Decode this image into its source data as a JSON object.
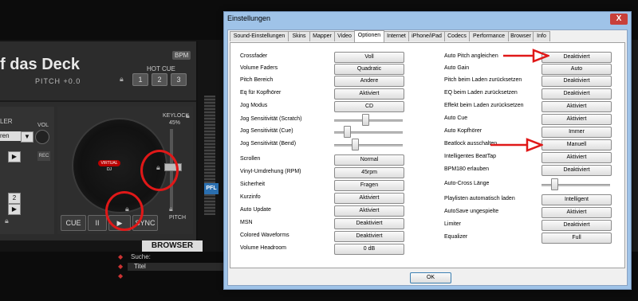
{
  "background_app": {
    "deck_title": "f das Deck",
    "bpm_badge": "BPM",
    "pitch_readout": "PITCH +0.0",
    "hot_cue_label": "HOT CUE",
    "hot_cue_buttons": [
      "1",
      "2",
      "3"
    ],
    "ler_label": "LER",
    "vol_label": "VOL",
    "select_value": "ren",
    "rec_label": "REC",
    "keylock_label": "KEYLOCK",
    "keylock_value": "45%",
    "pitch_label": "PITCH",
    "pfl_label": "PFL",
    "transport": {
      "cue": "CUE",
      "pause": "II",
      "play": "▶",
      "sync": "SYNC"
    },
    "platter_logo": "VIRTUAL DJ",
    "browser_tab": "BROWSER",
    "search_label": "Suche:",
    "list_header": "Titel",
    "side_numbers": [
      "2",
      "2"
    ]
  },
  "dialog": {
    "title": "Einstellungen",
    "close_label": "X",
    "tabs": [
      "Sound-Einstellungen",
      "Skins",
      "Mapper",
      "Video",
      "Optionen",
      "Internet",
      "iPhone/iPad",
      "Codecs",
      "Performance",
      "Browser",
      "Info"
    ],
    "active_tab": "Optionen",
    "left_options": [
      {
        "label": "Crossfader",
        "value": "Voll"
      },
      {
        "label": "Volume Faders",
        "value": "Quadratic"
      },
      {
        "label": "Pitch Bereich",
        "value": "Andere"
      },
      {
        "label": "Eq für Kopfhörer",
        "value": "Aktiviert"
      },
      {
        "label": "Jog Modus",
        "value": "CD"
      },
      {
        "label": "Jog Sensitivität (Scratch)",
        "slider": 0.45
      },
      {
        "label": "Jog Sensitivität (Cue)",
        "slider": 0.15
      },
      {
        "label": "Jog Sensitivität (Bend)",
        "slider": 0.28
      },
      {
        "label": "Scrollen",
        "value": "Normal"
      },
      {
        "label": "VinyI-Umdrehung (RPM)",
        "value": "45rpm"
      },
      {
        "label": "Sicherheit",
        "value": "Fragen"
      },
      {
        "label": "Kurzinfo",
        "value": "Aktiviert"
      },
      {
        "label": "Auto Update",
        "value": "Aktiviert"
      },
      {
        "label": "MSN",
        "value": "Deaktiviert"
      },
      {
        "label": "Colored Waveforms",
        "value": "Deaktiviert"
      },
      {
        "label": "Volume Headroom",
        "value": "0 dB"
      }
    ],
    "right_options": [
      {
        "label": "Auto Pitch angleichen",
        "value": "Deaktiviert"
      },
      {
        "label": "Auto Gain",
        "value": "Auto"
      },
      {
        "label": "Pitch beim Laden zurücksetzen",
        "value": "Deaktiviert"
      },
      {
        "label": "EQ beim Laden zurücksetzen",
        "value": "Deaktiviert"
      },
      {
        "label": "Effekt beim Laden zurücksetzen",
        "value": "Aktiviert"
      },
      {
        "label": "Auto Cue",
        "value": "Aktiviert"
      },
      {
        "label": "Auto Kopfhörer",
        "value": "Immer"
      },
      {
        "label": "Beatlock ausschalten",
        "value": "Manuell"
      },
      {
        "label": "Intelligentes BeatTap",
        "value": "Aktiviert"
      },
      {
        "label": "BPM180 erlauben",
        "value": "Deaktiviert"
      },
      {
        "label": "Auto-Cross Länge",
        "slider": 0.15
      },
      {
        "label": "Playlisten automatisch laden",
        "value": "Intelligent"
      },
      {
        "label": "AutoSave ungespielte",
        "value": "Aktiviert"
      },
      {
        "label": "Limiter",
        "value": "Deaktiviert"
      },
      {
        "label": "Equalizer",
        "value": "Full"
      }
    ],
    "ok_label": "OK"
  },
  "colors": {
    "annotation_red": "#e01818",
    "dialog_frame": "#9fc3e8",
    "pfl_blue": "#2a6fb0"
  }
}
